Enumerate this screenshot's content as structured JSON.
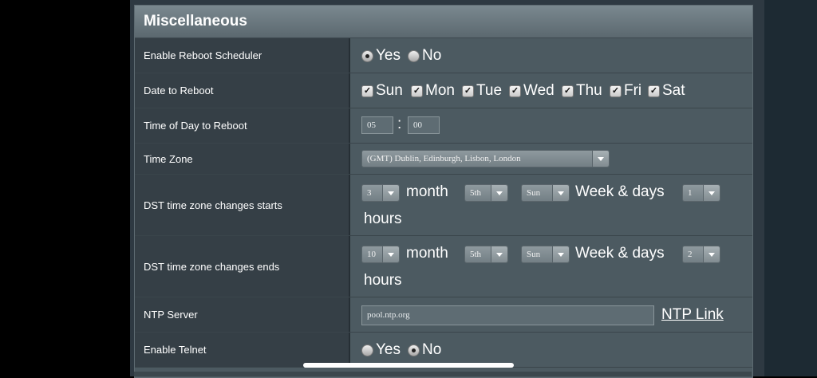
{
  "section_title": "Miscellaneous",
  "rows": {
    "reboot_scheduler": {
      "label": "Enable Reboot Scheduler",
      "yes": "Yes",
      "no": "No",
      "selected": "Yes"
    },
    "date_to_reboot": {
      "label": "Date to Reboot",
      "days": [
        "Sun",
        "Mon",
        "Tue",
        "Wed",
        "Thu",
        "Fri",
        "Sat"
      ],
      "all_checked": true,
      "check_glyph": "✓"
    },
    "time_of_day": {
      "label": "Time of Day to Reboot",
      "hour": "05",
      "minute": "00",
      "separator": ":"
    },
    "time_zone": {
      "label": "Time Zone",
      "selected": "(GMT) Dublin, Edinburgh, Lisbon, London"
    },
    "dst_start": {
      "label": "DST time zone changes starts",
      "month": "3",
      "week": "5th",
      "day": "Sun",
      "hour": "1",
      "month_text": "month",
      "week_days_text": "Week & days",
      "hours_text": "hours"
    },
    "dst_end": {
      "label": "DST time zone changes ends",
      "month": "10",
      "week": "5th",
      "day": "Sun",
      "hour": "2",
      "month_text": "month",
      "week_days_text": "Week & days",
      "hours_text": "hours"
    },
    "ntp_server": {
      "label": "NTP Server",
      "value": "pool.ntp.org",
      "link": "NTP Link"
    },
    "telnet": {
      "label": "Enable Telnet",
      "yes": "Yes",
      "no": "No",
      "selected": "No"
    }
  },
  "colors": {
    "panel": "#4c5a61",
    "label_bg": "#353f46",
    "header": "#6b787f"
  }
}
